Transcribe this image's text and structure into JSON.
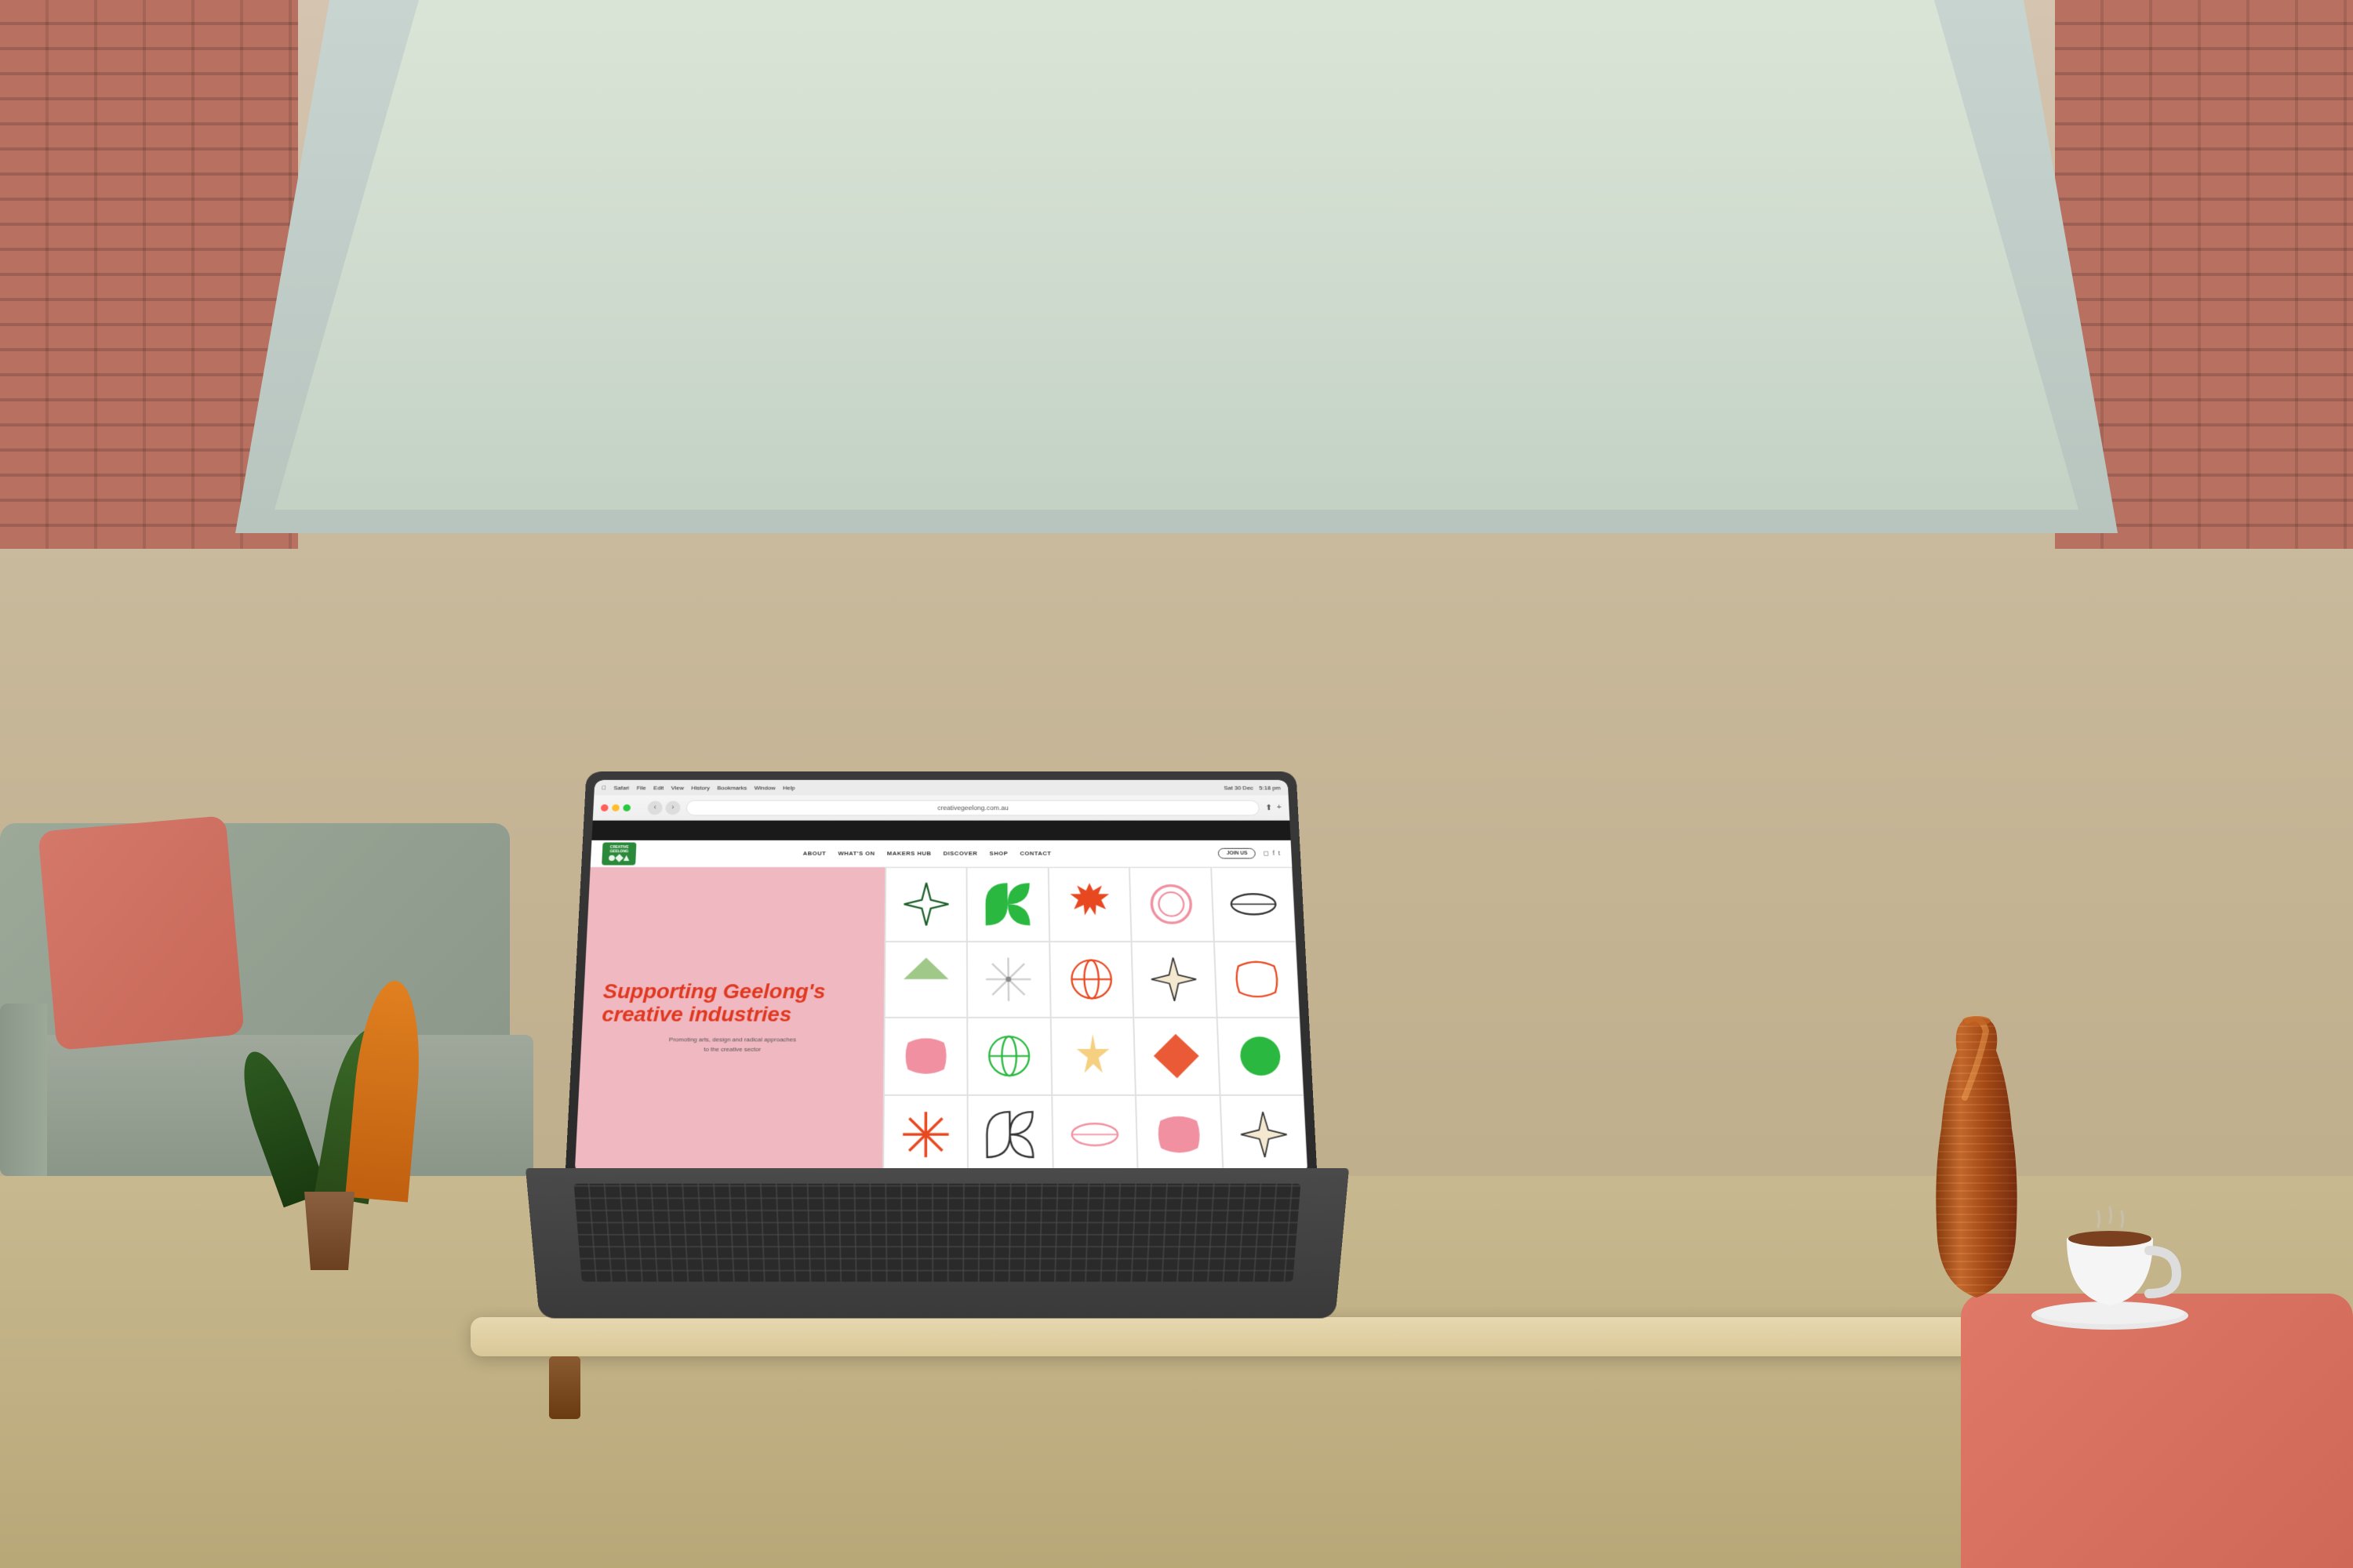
{
  "scene": {
    "background_color": "#c4a882",
    "title": "Creative Geelong Website on Laptop"
  },
  "laptop": {
    "screen": {
      "macos_topbar": {
        "left_items": [
          "Safari",
          "File",
          "Edit",
          "View",
          "History",
          "Bookmarks",
          "Window",
          "Help"
        ],
        "right_items": [
          "Sat 30 Dec",
          "5:18 pm"
        ],
        "dots": [
          "red",
          "yellow",
          "green"
        ]
      },
      "browser": {
        "address": "creativegeelong.com.au",
        "nav_buttons": [
          "←",
          "→",
          "↻"
        ]
      },
      "website": {
        "logo_text": "CREATIVE\nGEELONG",
        "nav_items": [
          "ABOUT",
          "WHAT'S ON",
          "MAKERS HUB",
          "DISCOVER",
          "SHOP",
          "CONTACT"
        ],
        "join_button": "JOIN US",
        "hero_title_line1": "Supporting Geelong's",
        "hero_title_line2": "creative industries",
        "hero_subtitle": "Promoting arts, design and radical approaches\nto the creative sector",
        "hero_bg_color": "#f0b8c0",
        "hero_title_color": "#e03820"
      }
    }
  },
  "shapes": {
    "colors": {
      "green": "#2ab840",
      "orange_red": "#e84820",
      "pink": "#f090a0",
      "cream": "#f5e8d0",
      "dark_green": "#1a6028"
    }
  },
  "ui": {
    "social_icons": [
      "instagram",
      "facebook",
      "twitter"
    ]
  }
}
